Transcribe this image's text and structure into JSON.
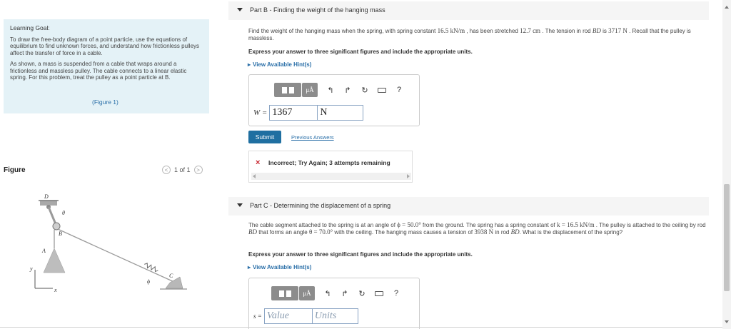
{
  "learning_goal": {
    "title": "Learning Goal:",
    "paragraphs": [
      "To draw the free-body diagram of a point particle, use the equations of equilibrium to find unknown forces, and understand how frictionless pulleys affect the transfer of force in a cable.",
      "As shown, a mass is suspended from a cable that wraps around a frictionless and massless pulley. The cable connects to a linear elastic spring. For this problem, treat the pulley as a point particle at B."
    ],
    "figure_link": "(Figure 1)"
  },
  "figure_panel": {
    "title": "Figure",
    "pager_text": "1 of 1",
    "prev_glyph": "<",
    "next_glyph": ">",
    "labels": {
      "D": "D",
      "theta": "θ",
      "B": "B",
      "A": "A",
      "y": "y",
      "x": "x",
      "C": "C",
      "phi": "ϕ"
    }
  },
  "part_b": {
    "title": "Part B - Finding the weight of the hanging mass",
    "problem": {
      "t1": "Find the weight of the hanging mass when the spring, with spring constant ",
      "m1": "16.5 kN/m",
      "t2": " , has been stretched ",
      "m2": "12.7 cm",
      "t3": " . The tension in rod ",
      "m3": "BD",
      "t4": " is ",
      "m4": "3717 N",
      "t5": " . Recall that the pulley is massless."
    },
    "instruction": "Express your answer to three significant figures and include the appropriate units.",
    "hint": "View Available Hint(s)",
    "answer_label": "W =",
    "answer_value": "1367",
    "answer_unit": "N",
    "submit_label": "Submit",
    "previous_answers_label": "Previous Answers",
    "feedback_text": "Incorrect; Try Again; 3 attempts remaining",
    "feedback_icon": "×"
  },
  "part_c": {
    "title": "Part C - Determining the displacement of a spring",
    "problem": {
      "t1": "The cable segment attached to the spring is at an angle of ",
      "m1": "ϕ = 50.0°",
      "t2": " from the ground. The spring has a spring constant of ",
      "m2": "k = 16.5 kN/m",
      "t3": " . The pulley is attached to the ceiling by rod ",
      "m3": "BD",
      "t4": " that forms an angle ",
      "m4": "θ = 70.0°",
      "t5": " with the ceiling. The hanging mass causes a tension of ",
      "m5": "3938 N",
      "t6": " in rod ",
      "m6": "BD",
      "t7": ". What is the displacement of the spring?"
    },
    "instruction": "Express your answer to three significant figures and include the appropriate units.",
    "hint": "View Available Hint(s)",
    "answer_label": "s =",
    "value_placeholder": "Value",
    "units_placeholder": "Units"
  },
  "toolbar": {
    "units_label": "μÅ",
    "undo_glyph": "↰",
    "redo_glyph": "↱",
    "reset_glyph": "↻",
    "help_glyph": "?"
  }
}
